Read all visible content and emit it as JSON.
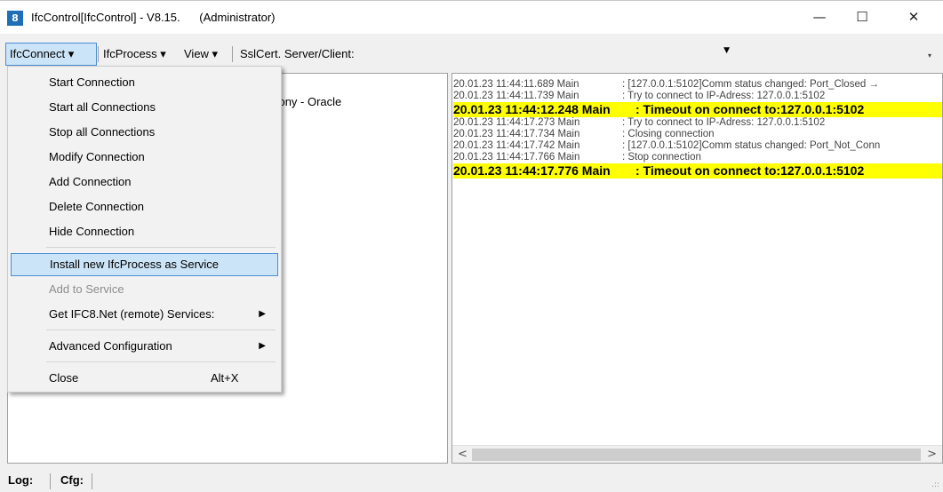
{
  "window": {
    "title": "IfcControl[IfcControl] - V8.15.",
    "admin": "(Administrator)",
    "icon_label": "8",
    "minimize_icon": "—",
    "maximize_icon": "☐",
    "close_icon": "✕"
  },
  "menubar": {
    "ifcconnect": "IfcConnect ▾",
    "ifcprocess": "IfcProcess ▾",
    "view": "View ▾",
    "sslcert": "SslCert. Server/Client:",
    "combo_value": "",
    "combo_arrow": "▼",
    "overflow": "▾"
  },
  "left_panel": {
    "visible_text": "phony - Oracle"
  },
  "dropdown": {
    "items": [
      {
        "label": "Start Connection"
      },
      {
        "label": "Start all Connections"
      },
      {
        "label": "Stop all Connections"
      },
      {
        "label": "Modify Connection"
      },
      {
        "label": "Add Connection"
      },
      {
        "label": "Delete Connection"
      },
      {
        "label": "Hide Connection"
      },
      {
        "label": "Install new IfcProcess as Service"
      },
      {
        "label": "Add to Service"
      },
      {
        "label": "Get IFC8.Net (remote) Services:",
        "arrow": "▶"
      },
      {
        "label": "Advanced Configuration",
        "arrow": "▶"
      },
      {
        "label": "Close",
        "shortcut": "Alt+X"
      }
    ]
  },
  "log": {
    "lines": [
      {
        "ts": "20.01.23 11:44:11.689 Main",
        "msg": ": [127.0.0.1:5102]Comm status changed: Port_Closed →"
      },
      {
        "ts": "20.01.23 11:44:11.739 Main",
        "msg": ": Try to connect to IP-Adress: 127.0.0.1:5102"
      },
      {
        "ts": "20.01.23 11:44:12.248 Main",
        "msg": ": Timeout on connect to:127.0.0.1:5102",
        "highlight": true
      },
      {
        "ts": "20.01.23 11:44:17.273 Main",
        "msg": ": Try to connect to IP-Adress: 127.0.0.1:5102"
      },
      {
        "ts": "20.01.23 11:44:17.734 Main",
        "msg": ": Closing connection"
      },
      {
        "ts": "20.01.23 11:44:17.742 Main",
        "msg": ": [127.0.0.1:5102]Comm status changed: Port_Not_Conn"
      },
      {
        "ts": "20.01.23 11:44:17.766 Main",
        "msg": ": Stop connection"
      },
      {
        "ts": "20.01.23 11:44:17.776 Main",
        "msg": ": Timeout on connect to:127.0.0.1:5102",
        "highlight": true
      }
    ],
    "highlight_color": "#ffff00",
    "scroll_left": "<",
    "scroll_right": ">"
  },
  "statusbar": {
    "log_label": "Log:",
    "cfg_label": "Cfg:",
    "grip": ".::"
  }
}
